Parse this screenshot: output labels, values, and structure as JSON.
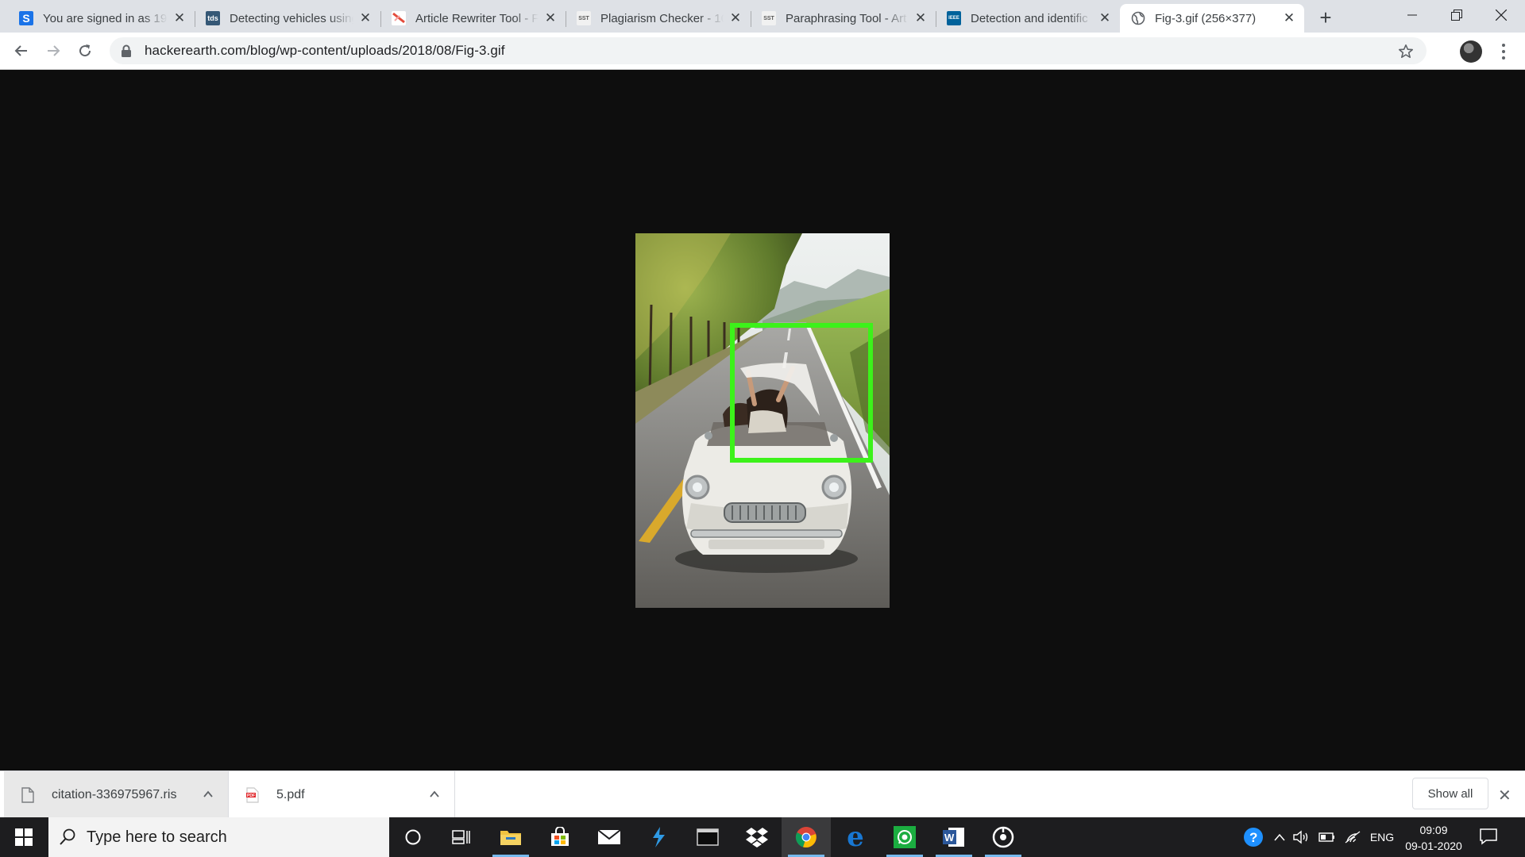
{
  "tabs": [
    {
      "title": "You are signed in as 19",
      "favicon": "S",
      "favicon_color": "#1a73e8"
    },
    {
      "title": "Detecting vehicles using",
      "favicon": "tds",
      "favicon_color": "#355876"
    },
    {
      "title": "Article Rewriter Tool - F",
      "favicon": "",
      "favicon_color": "#e34b3b"
    },
    {
      "title": "Plagiarism Checker - 10",
      "favicon": "SST",
      "favicon_color": "#f1f1f1"
    },
    {
      "title": "Paraphrasing Tool - Art",
      "favicon": "SST",
      "favicon_color": "#f1f1f1"
    },
    {
      "title": "Detection and identific",
      "favicon": "IEEE",
      "favicon_color": "#00629b"
    },
    {
      "title": "Fig-3.gif (256×377)",
      "favicon": "globe-icon",
      "favicon_color": "#5f6368"
    }
  ],
  "address_bar": {
    "url": "hackerearth.com/blog/wp-content/uploads/2018/08/Fig-3.gif"
  },
  "image_viewer": {
    "alt": "Fig-3.gif",
    "box_color": "#3cf21a"
  },
  "downloads": [
    {
      "filename": "citation-336975967.ris",
      "icon": "file-icon"
    },
    {
      "filename": "5.pdf",
      "icon": "pdf-icon"
    }
  ],
  "download_bar": {
    "show_all_label": "Show all"
  },
  "taskbar": {
    "search_placeholder": "Type here to search",
    "language": "ENG",
    "time": "09:09",
    "date": "09-01-2020",
    "apps": [
      "cortana-icon",
      "task-view-icon",
      "file-explorer-icon",
      "store-icon",
      "mail-icon",
      "visual-studio-icon",
      "terminal-icon",
      "dropbox-icon",
      "chrome-icon",
      "edge-icon",
      "whatsapp-icon",
      "word-icon",
      "groove-music-icon"
    ]
  }
}
